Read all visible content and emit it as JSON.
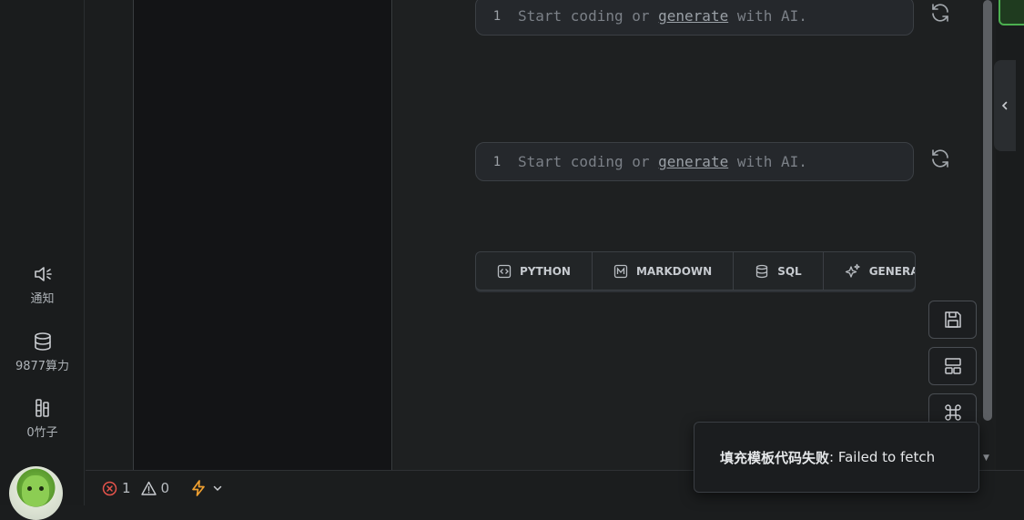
{
  "nav": {
    "notifications_label": "通知",
    "compute_label": "9877算力",
    "bamboo_label": "0竹子"
  },
  "cells": [
    {
      "line_number": "1",
      "prefix": "Start coding or",
      "link": "generate",
      "suffix": "with AI."
    },
    {
      "line_number": "1",
      "prefix": "Start coding or",
      "link": "generate",
      "suffix": "with AI."
    }
  ],
  "add_bar": {
    "python": "PYTHON",
    "markdown": "MARKDOWN",
    "sql": "SQL",
    "generate": "GENERATE"
  },
  "status_bar": {
    "errors": "1",
    "warnings": "0"
  },
  "toast": {
    "prefix": "填充模板代码失败",
    "message": ": Failed to fetch"
  },
  "colors": {
    "error": "#e5534b",
    "lightning": "#f0a030",
    "accent_green": "#4caf50"
  },
  "icons": [
    "speaker-icon",
    "database-icon",
    "bamboo-icon",
    "refresh-icon",
    "code-icon",
    "markdown-icon",
    "sql-icon",
    "sparkle-icon",
    "save-icon",
    "layout-icon",
    "command-icon",
    "error-icon",
    "warning-icon",
    "lightning-icon",
    "chevron-down-icon",
    "chevron-left-icon"
  ]
}
